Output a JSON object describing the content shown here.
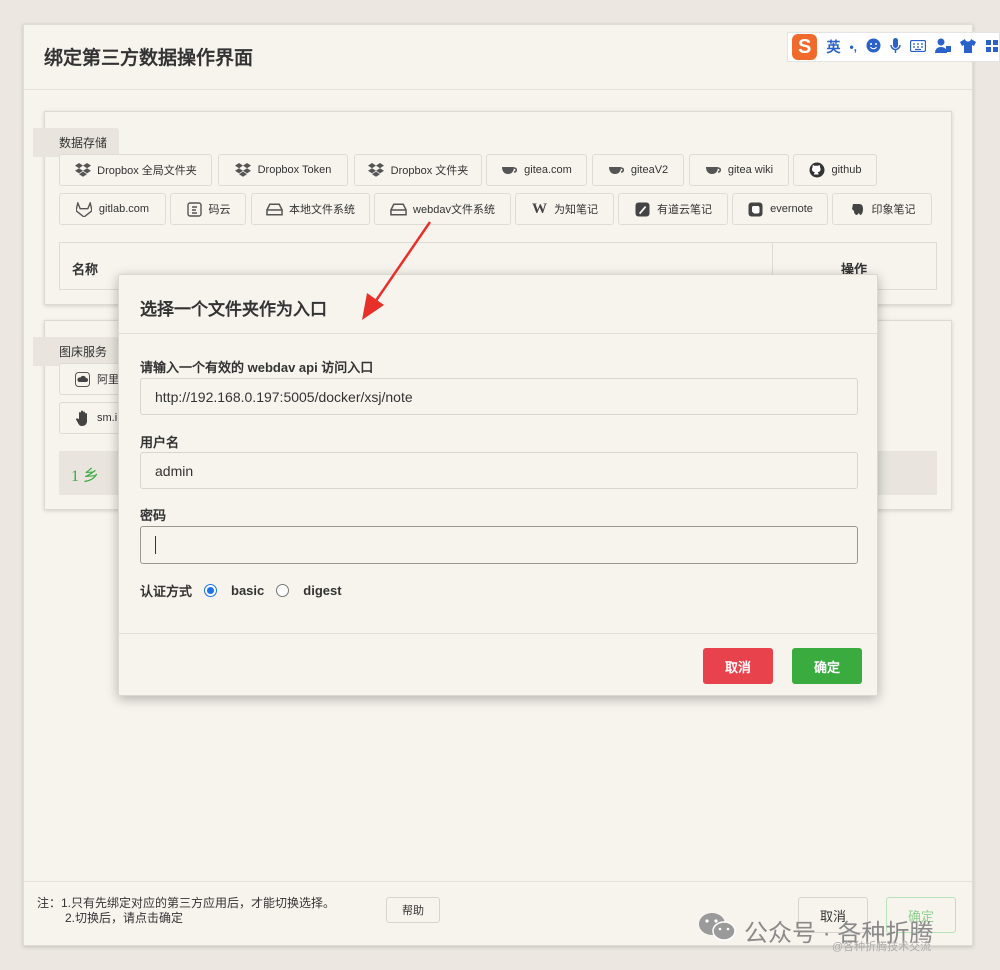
{
  "window": {
    "title": "绑定第三方数据操作界面"
  },
  "ime": {
    "lang": "英",
    "punct": "•,"
  },
  "storage": {
    "section_label": "数据存储",
    "services_row1": [
      "Dropbox 全局文件夹",
      "Dropbox Token",
      "Dropbox 文件夹",
      "gitea.com",
      "giteaV2",
      "gitea wiki",
      "github"
    ],
    "services_row2": [
      "gitlab.com",
      "码云",
      "本地文件系统",
      "webdav文件系统",
      "为知笔记",
      "有道云笔记",
      "evernote",
      "印象笔记"
    ],
    "table": {
      "col_name": "名称",
      "col_action": "操作"
    }
  },
  "image_host": {
    "section_label": "图床服务",
    "services": [
      "阿里",
      "sm.i"
    ],
    "status_text": "1 乡 "
  },
  "footer": {
    "note_line1": "注：1.只有先绑定对应的第三方应用后，才能切换选择。",
    "note_line2": "2.切换后，请点击确定",
    "help_label": "帮助",
    "cancel_label": "取消",
    "ok_label": "确定"
  },
  "modal": {
    "title": "选择一个文件夹作为入口",
    "url_label": "请输入一个有效的 webdav api 访问入口",
    "url_value": "http://192.168.0.197:5005/docker/xsj/note",
    "user_label": "用户名",
    "user_value": "admin",
    "password_label": "密码",
    "password_value": "",
    "auth_label": "认证方式",
    "auth_options": [
      "basic",
      "digest"
    ],
    "auth_selected": "basic",
    "cancel_label": "取消",
    "ok_label": "确定"
  },
  "watermark": {
    "text": "公众号 · 各种折腾",
    "sub": "@各种折腾技术交流"
  },
  "colors": {
    "cancel": "#e8424c",
    "ok": "#3aab3f",
    "radio": "#1a73e8",
    "arrow": "#e8302a"
  }
}
